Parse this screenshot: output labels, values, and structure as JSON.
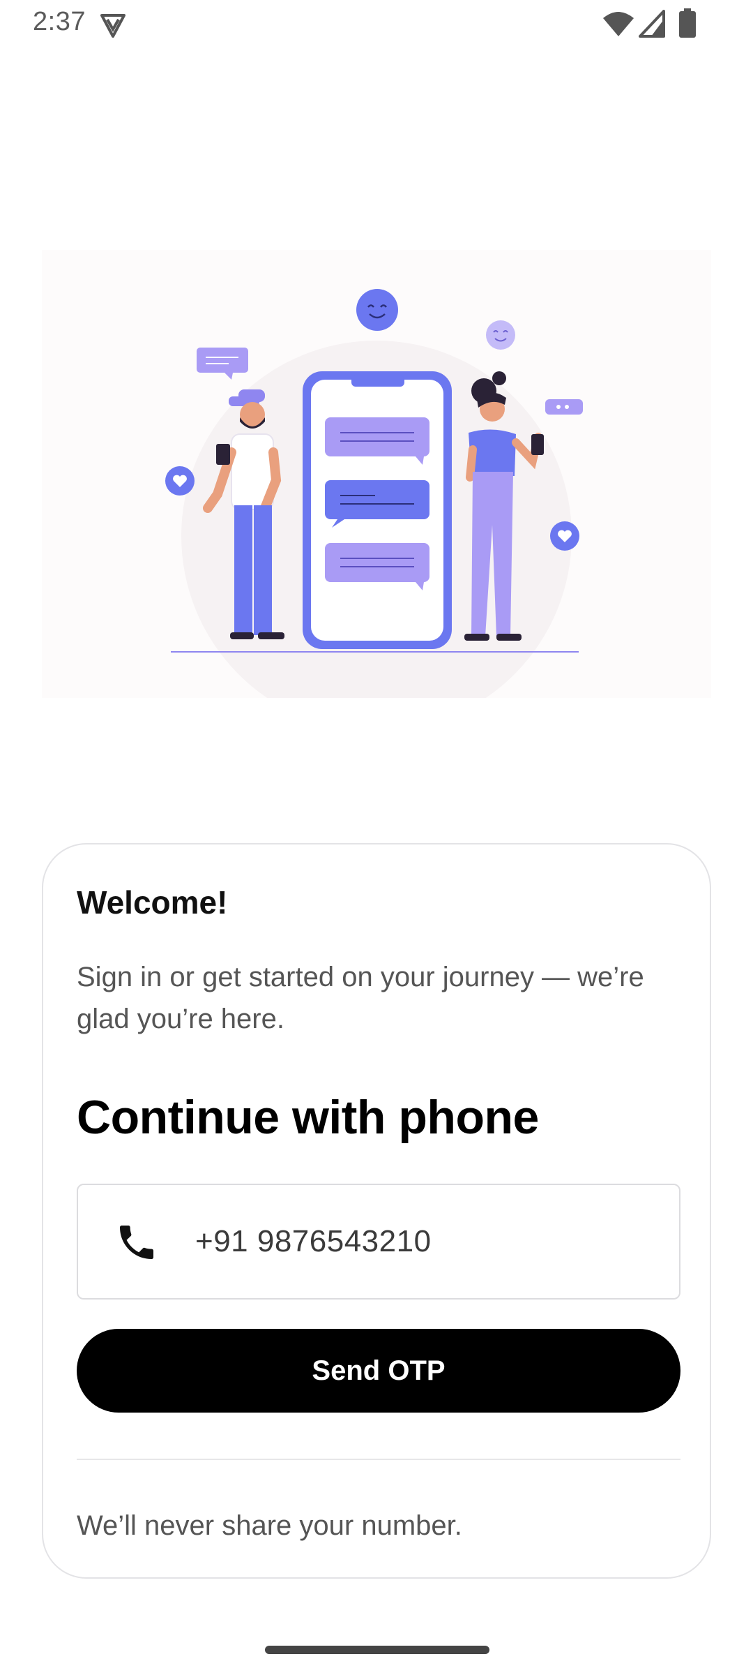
{
  "status_bar": {
    "time": "2:37",
    "icons": [
      "vpn-icon",
      "wifi-icon",
      "signal-icon",
      "battery-icon"
    ]
  },
  "card": {
    "welcome": "Welcome!",
    "subtitle": "Sign in or get started on your journey — we’re glad you’re here.",
    "heading": "Continue with phone",
    "phone_field": {
      "icon": "phone-icon",
      "value": "+91 9876543210"
    },
    "send_button": "Send OTP",
    "privacy_note": "We’ll never share your number."
  },
  "colors": {
    "primary_button": "#000000",
    "illustration_accent": "#6B77F0",
    "illustration_light": "#A99BF5"
  }
}
